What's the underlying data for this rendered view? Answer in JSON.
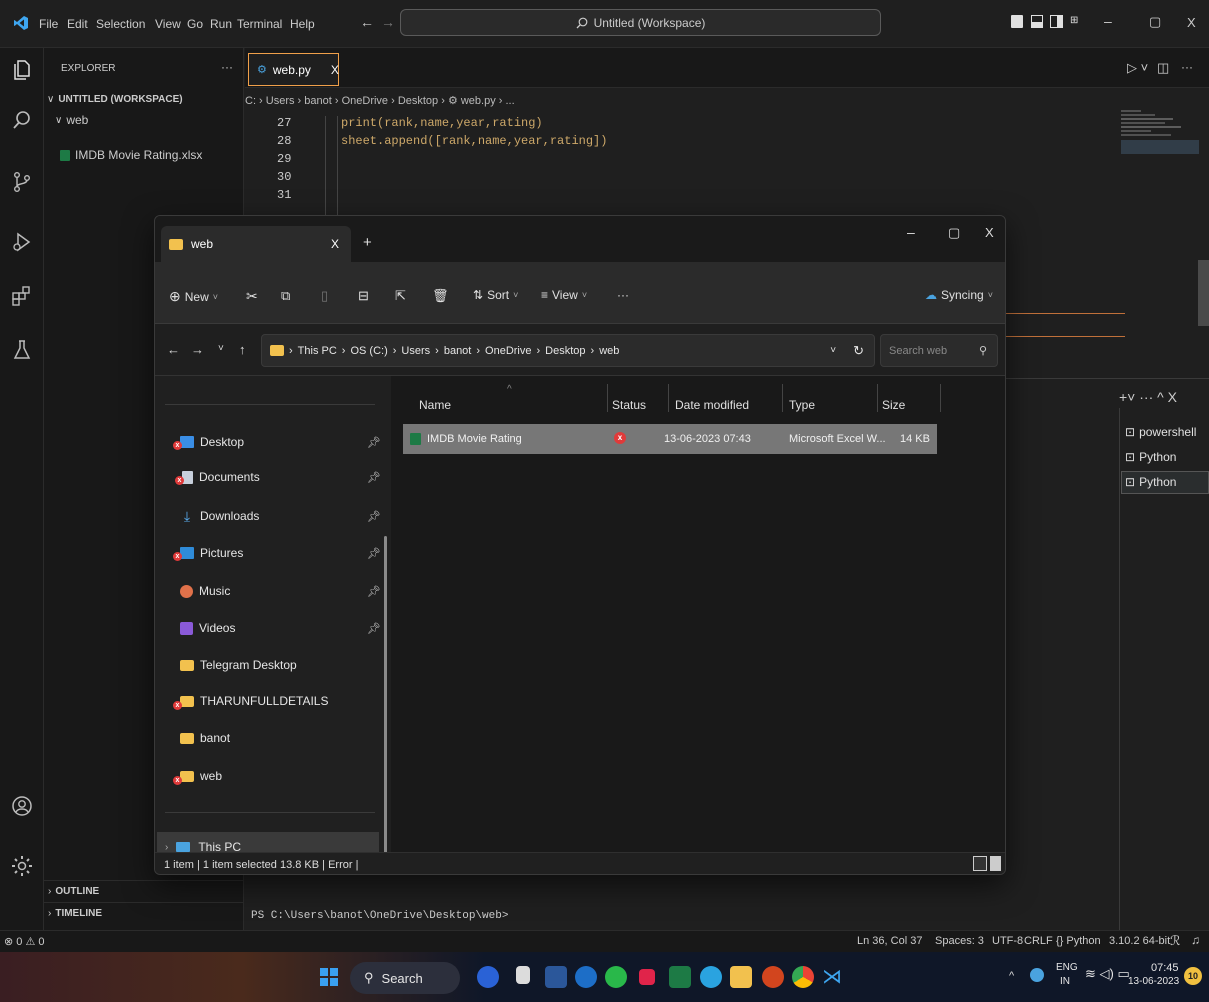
{
  "titlebar": {
    "menus": [
      "File",
      "Edit",
      "Selection",
      "View",
      "Go",
      "Run",
      "Terminal",
      "Help"
    ],
    "search_text": "Untitled (Workspace)",
    "minimize": "–",
    "maximize": "▢",
    "close": "X"
  },
  "sidebar": {
    "title": "EXPLORER",
    "more": "···",
    "workspace": "UNTITLED (WORKSPACE)",
    "folder": "web",
    "file": "IMDB Movie Rating.xlsx",
    "outline": "OUTLINE",
    "timeline": "TIMELINE"
  },
  "editor": {
    "tab_label": "web.py",
    "tab_close": "X",
    "breadcrumb": "C: › Users › banot › OneDrive › Desktop › ⚙ web.py › ...",
    "lines": [
      {
        "num": "27",
        "code": "print(rank,name,year,rating)"
      },
      {
        "num": "28",
        "code": "sheet.append([rank,name,year,rating])"
      },
      {
        "num": "29",
        "code": ""
      },
      {
        "num": "30",
        "code": ""
      },
      {
        "num": "31",
        "code": ""
      }
    ],
    "terminal_prompt": "PS C:\\Users\\banot\\OneDrive\\Desktop\\web>",
    "terminals": [
      "powershell",
      "Python",
      "Python"
    ]
  },
  "statusbar": {
    "left": "⊗ 0 ⚠ 0",
    "ln_col": "Ln 36, Col 37",
    "spaces": "Spaces: 3",
    "encoding": "UTF-8",
    "eol": "CRLF",
    "lang": "{} Python",
    "interpreter": "3.10.2 64-bit"
  },
  "explorer": {
    "tab_title": "web",
    "tab_close": "X",
    "new_tab": "+",
    "minimize": "–",
    "maximize": "▢",
    "close": "X",
    "toolbar": {
      "new": "New",
      "sort": "Sort",
      "view": "View",
      "more": "···",
      "syncing": "Syncing"
    },
    "address": [
      "This PC",
      "OS (C:)",
      "Users",
      "banot",
      "OneDrive",
      "Desktop",
      "web"
    ],
    "search_placeholder": "Search web",
    "nav": [
      {
        "label": "Desktop",
        "pinned": true,
        "error": true
      },
      {
        "label": "Documents",
        "pinned": true,
        "error": true
      },
      {
        "label": "Downloads",
        "pinned": true,
        "error": false
      },
      {
        "label": "Pictures",
        "pinned": true,
        "error": true
      },
      {
        "label": "Music",
        "pinned": true,
        "error": false
      },
      {
        "label": "Videos",
        "pinned": true,
        "error": false
      },
      {
        "label": "Telegram Desktop",
        "pinned": false,
        "error": false
      },
      {
        "label": "THARUNFULLDETAILS",
        "pinned": false,
        "error": true
      },
      {
        "label": "banot",
        "pinned": false,
        "error": false
      },
      {
        "label": "web",
        "pinned": false,
        "error": true
      }
    ],
    "this_pc": "This PC",
    "columns": {
      "name": "Name",
      "status": "Status",
      "date": "Date modified",
      "type": "Type",
      "size": "Size"
    },
    "row": {
      "name": "IMDB Movie Rating",
      "date": "13-06-2023 07:43",
      "type": "Microsoft Excel W...",
      "size": "14 KB"
    },
    "status_text": "1 item  |  1 item selected  13.8 KB  |  Error  |"
  },
  "taskbar": {
    "search": "Search",
    "lang1": "ENG",
    "lang2": "IN",
    "time": "07:45",
    "date": "13-06-2023",
    "badge": "10"
  },
  "colors": {
    "accent": "#0078d4",
    "error": "#e03a3a",
    "folder": "#f2c14e",
    "excel": "#1d7a45"
  }
}
